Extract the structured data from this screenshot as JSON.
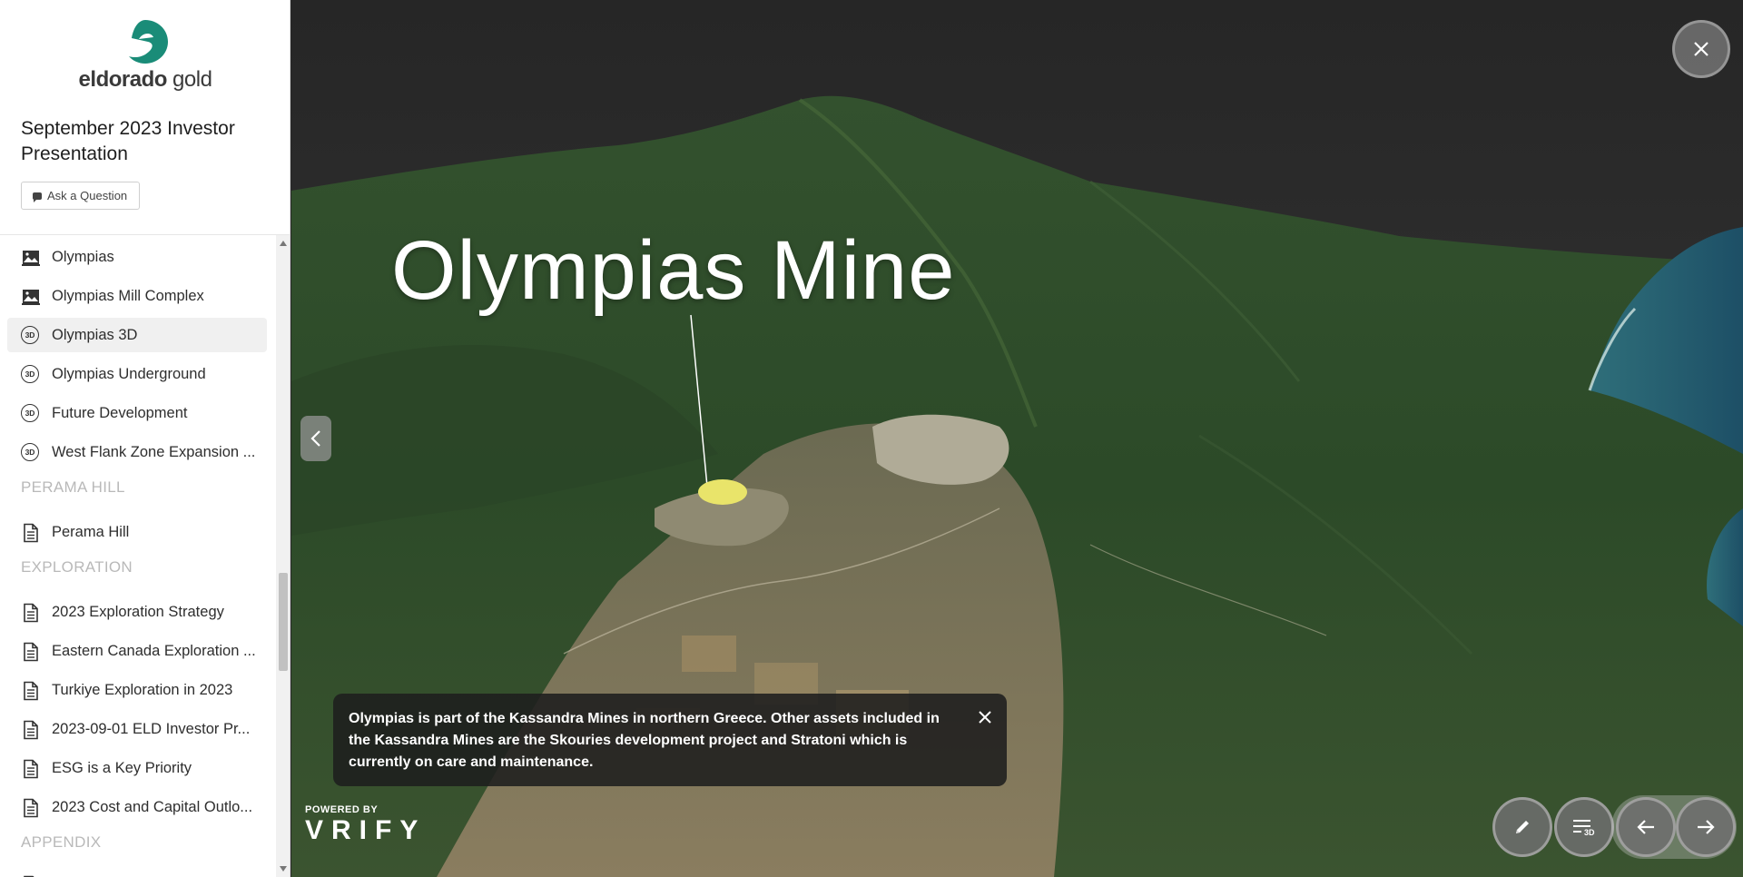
{
  "brand": {
    "logo_text_bold": "eldorado",
    "logo_text_light": " gold",
    "accent": "#1a8c78"
  },
  "sidebar": {
    "title": "September 2023 Investor Presentation",
    "ask_button": "Ask a Question",
    "items": [
      {
        "label": "Olympias",
        "icon": "drone-image-icon"
      },
      {
        "label": "Olympias Mill Complex",
        "icon": "drone-image-icon"
      },
      {
        "label": "Olympias 3D",
        "icon": "3d-icon",
        "active": true
      },
      {
        "label": "Olympias Underground",
        "icon": "3d-icon"
      },
      {
        "label": "Future Development",
        "icon": "3d-icon"
      },
      {
        "label": "West Flank Zone Expansion ...",
        "icon": "3d-icon"
      },
      {
        "label": "Perama Hill",
        "icon": "document-icon"
      },
      {
        "label": "2023 Exploration Strategy",
        "icon": "document-icon"
      },
      {
        "label": "Eastern Canada Exploration ...",
        "icon": "document-icon"
      },
      {
        "label": "Turkiye Exploration in 2023",
        "icon": "document-icon"
      },
      {
        "label": "2023-09-01 ELD Investor Pr...",
        "icon": "document-icon"
      },
      {
        "label": "ESG is a Key Priority",
        "icon": "document-icon"
      },
      {
        "label": "2023 Cost and Capital Outlo...",
        "icon": "document-icon"
      }
    ],
    "sections": {
      "perama": "PERAMA HILL",
      "exploration": "EXPLORATION",
      "appendix": "APPENDIX"
    }
  },
  "scene": {
    "title": "Olympias Mine",
    "info_text": "Olympias is part of the Kassandra Mines in northern Greece. Other assets included in the Kassandra Mines are the Skouries development project and Stratoni which is currently on care and maintenance.",
    "powered_label": "POWERED BY",
    "powered_brand": "VRIFY",
    "marker_color": "#e9e46a",
    "controls": [
      "pencil-icon",
      "3d-list-icon",
      "arrow-left-icon",
      "arrow-right-icon"
    ]
  }
}
